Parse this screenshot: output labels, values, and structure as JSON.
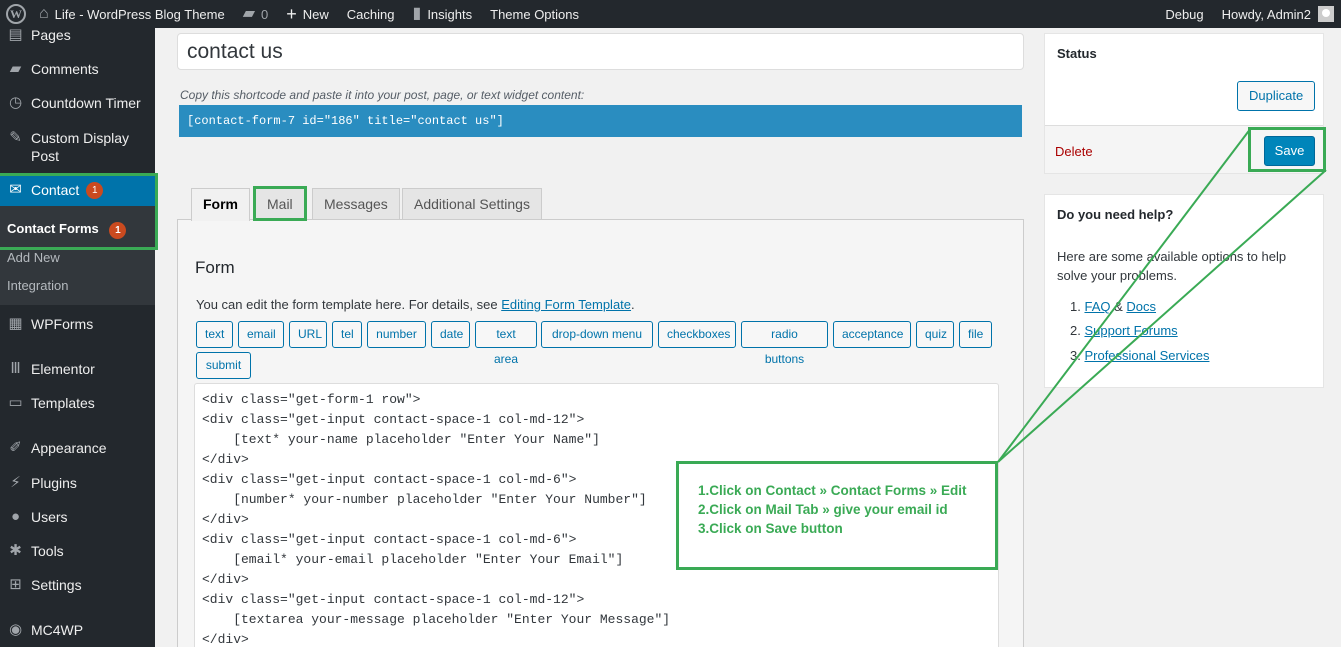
{
  "adminbar": {
    "site_name": "Life - WordPress Blog Theme",
    "comments_count": "0",
    "new_label": "New",
    "caching_label": "Caching",
    "insights_label": "Insights",
    "theme_options_label": "Theme Options",
    "debug_label": "Debug",
    "howdy_label": "Howdy, Admin2"
  },
  "sidebar": {
    "pages": "Pages",
    "comments": "Comments",
    "countdown_timer": "Countdown Timer",
    "custom_display_post_line1": "Custom Display",
    "custom_display_post_line2": "Post",
    "contact": "Contact",
    "contact_badge": "1",
    "contact_forms": "Contact Forms",
    "contact_forms_badge": "1",
    "add_new": "Add New",
    "integration": "Integration",
    "wpforms": "WPForms",
    "elementor": "Elementor",
    "templates": "Templates",
    "appearance": "Appearance",
    "plugins": "Plugins",
    "users": "Users",
    "tools": "Tools",
    "settings": "Settings",
    "mc4wp": "MC4WP"
  },
  "editor": {
    "title_value": "contact us",
    "shortcode_hint": "Copy this shortcode and paste it into your post, page, or text widget content:",
    "shortcode": "[contact-form-7 id=\"186\" title=\"contact us\"]"
  },
  "tabs": {
    "form": "Form",
    "mail": "Mail",
    "messages": "Messages",
    "additional_settings": "Additional Settings"
  },
  "form_panel": {
    "heading": "Form",
    "desc_prefix": "You can edit the form template here. For details, see ",
    "desc_link": "Editing Form Template",
    "desc_suffix": ".",
    "tag_buttons": [
      "text",
      "email",
      "URL",
      "tel",
      "number",
      "date",
      "text area",
      "drop-down menu",
      "checkboxes",
      "radio buttons",
      "acceptance",
      "quiz",
      "file",
      "submit"
    ],
    "code_lines": [
      "<div class=\"get-form-1 row\">",
      "<div class=\"get-input contact-space-1 col-md-12\">",
      "    [text* your-name placeholder \"Enter Your Name\"]",
      "</div>",
      "<div class=\"get-input contact-space-1 col-md-6\">",
      "    [number* your-number placeholder \"Enter Your Number\"]",
      "</div>",
      "<div class=\"get-input contact-space-1 col-md-6\">",
      "    [email* your-email placeholder \"Enter Your Email\"]",
      "</div>",
      "<div class=\"get-input contact-space-1 col-md-12\">",
      "    [textarea your-message placeholder \"Enter Your Message\"]",
      "</div>"
    ]
  },
  "status_box": {
    "title": "Status",
    "duplicate": "Duplicate",
    "delete": "Delete",
    "save": "Save"
  },
  "help_box": {
    "title": "Do you need help?",
    "text": "Here are some available options to help solve your problems.",
    "items": [
      {
        "num": "1.",
        "link1": "FAQ",
        "sep": " & ",
        "link2": "Docs"
      },
      {
        "num": "2.",
        "link1": "Support Forums"
      },
      {
        "num": "3.",
        "link1": "Professional Services"
      }
    ]
  },
  "annotation": {
    "lines": [
      "1.Click on Contact » Contact Forms » Edit",
      "2.Click on Mail Tab » give your email id",
      "3.Click on Save button"
    ],
    "color": "#3aaa55"
  },
  "colors": {
    "adminbar_bg": "#23282d",
    "menu_active": "#0073aa",
    "shortcode_bg": "#2a8dc0",
    "primary_button": "#0085ba",
    "badge": "#ca4a1f"
  }
}
